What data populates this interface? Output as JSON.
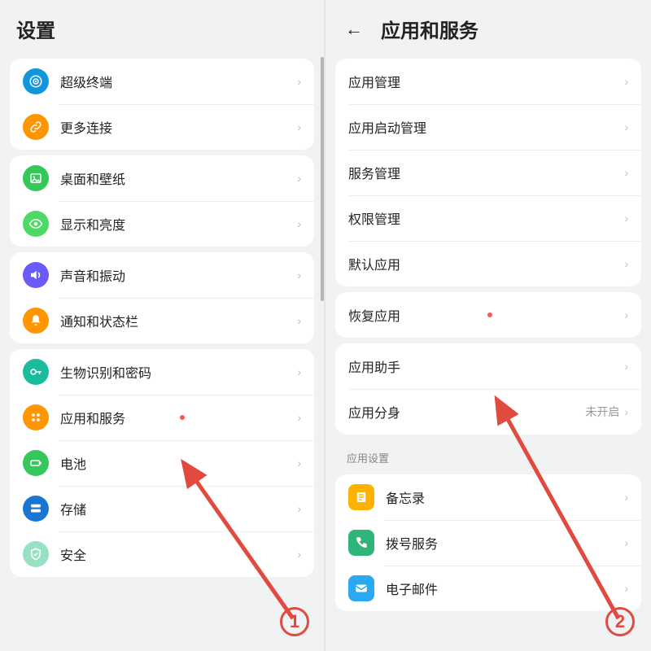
{
  "left": {
    "title": "设置",
    "groups": [
      [
        {
          "id": "super-terminal",
          "label": "超级终端",
          "icon": "target-icon",
          "color": "ic-blue"
        },
        {
          "id": "more-connect",
          "label": "更多连接",
          "icon": "link-icon",
          "color": "ic-orange"
        }
      ],
      [
        {
          "id": "wallpaper",
          "label": "桌面和壁纸",
          "icon": "image-icon",
          "color": "ic-green"
        },
        {
          "id": "display",
          "label": "显示和亮度",
          "icon": "eye-icon",
          "color": "ic-green2"
        }
      ],
      [
        {
          "id": "sound",
          "label": "声音和振动",
          "icon": "speaker-icon",
          "color": "ic-purple"
        },
        {
          "id": "notify",
          "label": "通知和状态栏",
          "icon": "bell-icon",
          "color": "ic-orange"
        }
      ],
      [
        {
          "id": "biometrics",
          "label": "生物识别和密码",
          "icon": "key-icon",
          "color": "ic-teal"
        },
        {
          "id": "apps-svc",
          "label": "应用和服务",
          "icon": "apps-icon",
          "color": "ic-orange",
          "dot": true
        },
        {
          "id": "battery",
          "label": "电池",
          "icon": "battery-icon",
          "color": "ic-green"
        },
        {
          "id": "storage",
          "label": "存储",
          "icon": "storage-icon",
          "color": "ic-blue2"
        },
        {
          "id": "security",
          "label": "安全",
          "icon": "shield-icon",
          "color": "ic-mint"
        }
      ]
    ]
  },
  "right": {
    "title": "应用和服务",
    "groups": [
      [
        {
          "id": "app-manage",
          "label": "应用管理"
        },
        {
          "id": "app-launch",
          "label": "应用启动管理"
        },
        {
          "id": "svc-manage",
          "label": "服务管理"
        },
        {
          "id": "perm-manage",
          "label": "权限管理"
        },
        {
          "id": "default-app",
          "label": "默认应用"
        }
      ],
      [
        {
          "id": "restore-app",
          "label": "恢复应用",
          "dot": true
        }
      ],
      [
        {
          "id": "app-assist",
          "label": "应用助手"
        },
        {
          "id": "app-twin",
          "label": "应用分身",
          "value": "未开启"
        }
      ]
    ],
    "apps_section_label": "应用设置",
    "apps": [
      {
        "id": "memo",
        "label": "备忘录",
        "icon": "note-icon",
        "color": "#ffb300"
      },
      {
        "id": "dialer",
        "label": "拨号服务",
        "icon": "phone-icon",
        "color": "#2fb57a"
      },
      {
        "id": "email",
        "label": "电子邮件",
        "icon": "mail-icon",
        "color": "#2aa8f2"
      }
    ]
  },
  "annotations": {
    "step1": "1",
    "step2": "2"
  }
}
